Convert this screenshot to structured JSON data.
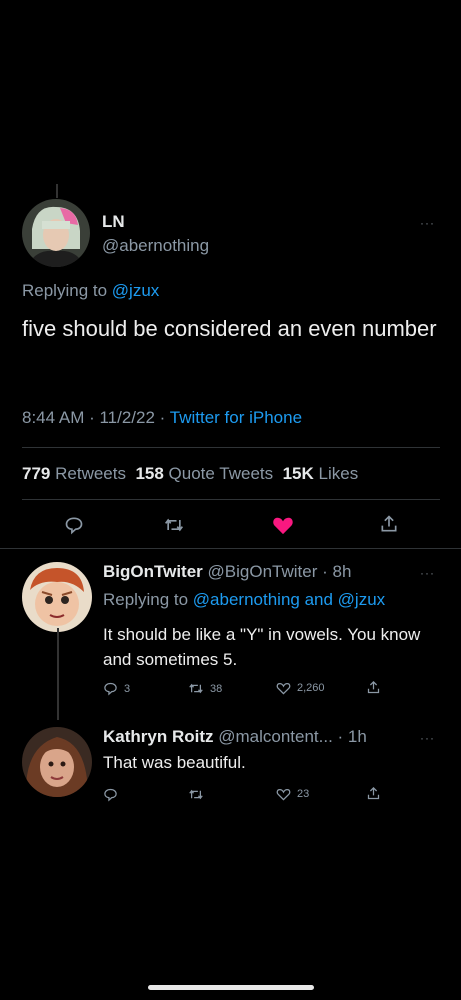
{
  "main_tweet": {
    "display_name": "LN",
    "handle": "@abernothing",
    "replying_prefix": "Replying to",
    "replying_to": "@jzux",
    "text": "five should be considered an even number",
    "timestamp": "8:44 AM · 11/2/22 ·",
    "source": "Twitter for iPhone",
    "stats": {
      "retweets_count": "779",
      "retweets_label": "Retweets",
      "quotes_count": "158",
      "quotes_label": "Quote Tweets",
      "likes_count": "15K",
      "likes_label": "Likes"
    },
    "more": "···"
  },
  "replies": [
    {
      "display_name": "BigOnTwiter",
      "handle_time": "@BigOnTwiter · 8h",
      "replying_prefix": "Replying to",
      "replying_to": "@abernothing and @jzux",
      "text": "It should be like a \"Y\" in vowels. You know and sometimes 5.",
      "reply_count": "3",
      "retweet_count": "38",
      "like_count": "2,260",
      "more": "···"
    },
    {
      "display_name": "Kathryn Roitz",
      "handle_time": "@malcontent... · 1h",
      "text": "That was beautiful.",
      "reply_count": "",
      "retweet_count": "",
      "like_count": "23",
      "more": "···"
    }
  ],
  "colors": {
    "accent": "#1d9bf0",
    "like": "#f91880",
    "background": "#000000"
  },
  "icons": [
    "reply-icon",
    "retweet-icon",
    "like-icon",
    "share-icon"
  ]
}
